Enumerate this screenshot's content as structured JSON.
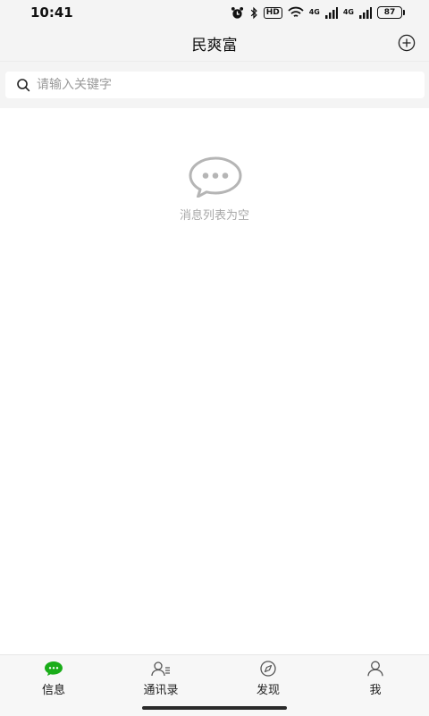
{
  "status_bar": {
    "time": "10:41",
    "hd_label": "HD",
    "signal_1": "4G",
    "signal_2": "4G",
    "battery": "87"
  },
  "header": {
    "title": "民爽富"
  },
  "search": {
    "placeholder": "请输入关键字",
    "value": ""
  },
  "empty_state": {
    "message": "消息列表为空"
  },
  "tabs": [
    {
      "label": "信息",
      "icon": "chat-bubble-icon",
      "active": true
    },
    {
      "label": "通讯录",
      "icon": "contacts-icon",
      "active": false
    },
    {
      "label": "发现",
      "icon": "compass-icon",
      "active": false
    },
    {
      "label": "我",
      "icon": "person-icon",
      "active": false
    }
  ],
  "colors": {
    "accent": "#1aad19",
    "background": "#f4f4f4",
    "muted_text": "#a8a8a8",
    "icon_gray": "#b5b5b5"
  }
}
